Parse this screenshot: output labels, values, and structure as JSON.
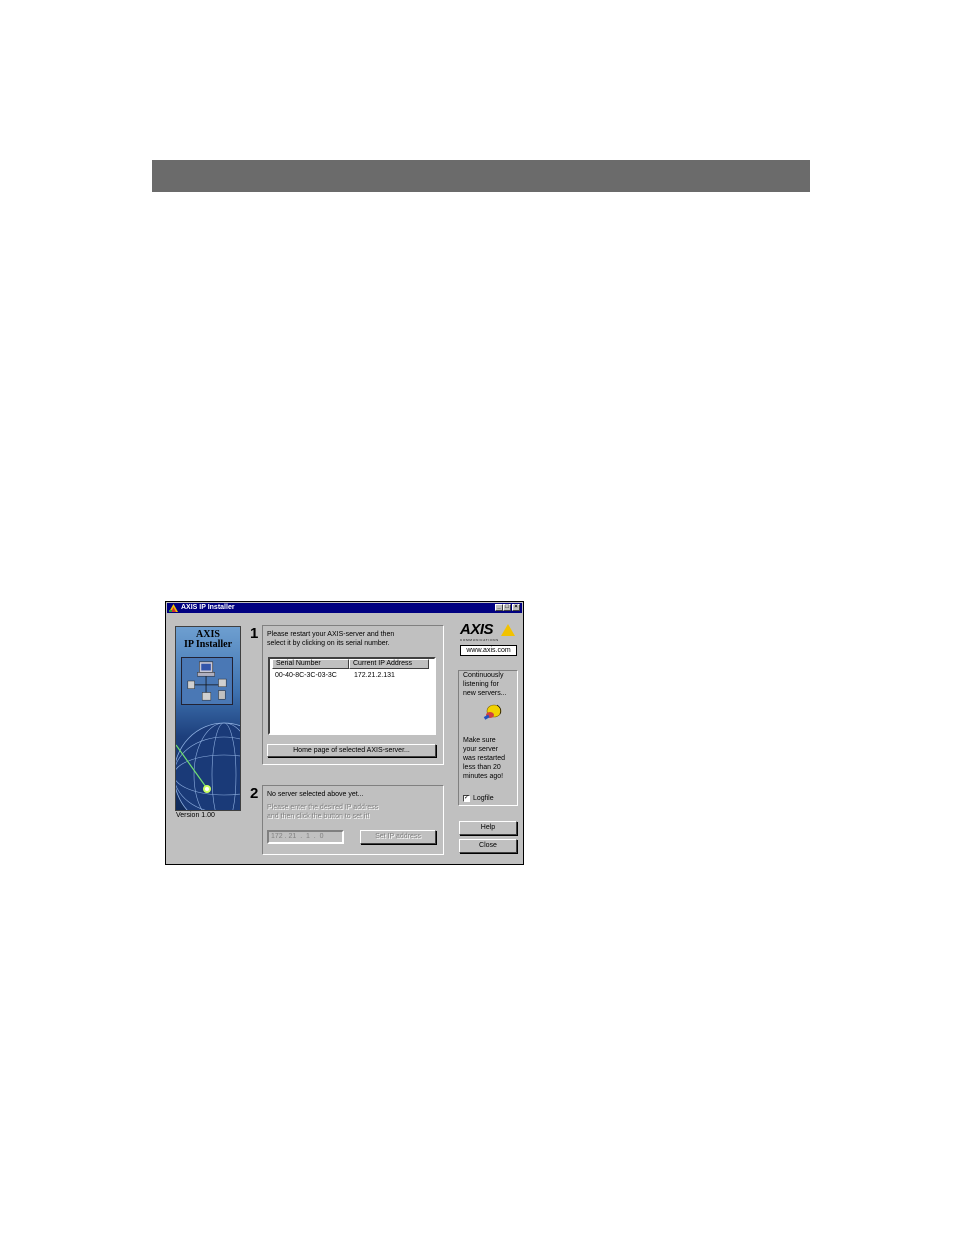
{
  "window": {
    "title": "AXIS IP Installer",
    "minimize_glyph": "_",
    "maximize_glyph": "□",
    "close_glyph": "×"
  },
  "banner": {
    "title_line1": "AXIS",
    "title_line2": "IP Installer",
    "version": "Version 1.00"
  },
  "step1": {
    "number": "1",
    "instruction_line1": "Please restart your AXIS-server and then",
    "instruction_line2": "select it by clicking on its serial number.",
    "columns": [
      "Serial Number",
      "Current IP Address"
    ],
    "rows": [
      {
        "serial": "00-40-8C-3C-03-3C",
        "ip": "172.21.2.131"
      }
    ],
    "home_button_label": "Home page of selected AXIS-server..."
  },
  "step2": {
    "number": "2",
    "status": "No server selected above yet...",
    "hint_line1": "Please enter the desired IP address",
    "hint_line2": "and then click the button to set it!",
    "ip_value": "172 . 21  .  1  .  0",
    "set_ip_button_label": "Set IP address"
  },
  "sidebar": {
    "logo_text": "AXIS",
    "logo_sub": "COMMUNICATIONS",
    "url": "www.axis.com",
    "listening_line1": "Continuously",
    "listening_line2": "listening for",
    "listening_line3": "new servers...",
    "note_line1": "Make sure",
    "note_line2": "your server",
    "note_line3": "was restarted",
    "note_line4": "less than 20",
    "note_line5": "minutes ago!",
    "logfile_label": "Logfile",
    "logfile_checked": true,
    "help_label": "Help",
    "close_label": "Close"
  },
  "colors": {
    "titlebar": "#000080",
    "face": "#c0c0c0",
    "page_header_bar": "#6b6b6b",
    "logo_triangle": "#f2c200"
  }
}
